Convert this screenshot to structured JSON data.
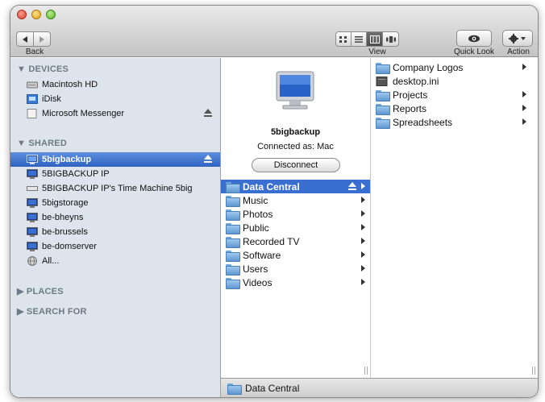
{
  "toolbar": {
    "back_label": "Back",
    "view_label": "View",
    "quicklook_label": "Quick Look",
    "action_label": "Action"
  },
  "sidebar": {
    "devices_header": "▼ DEVICES",
    "devices": [
      {
        "label": "Macintosh HD",
        "icon": "hard-drive-icon"
      },
      {
        "label": "iDisk",
        "icon": "idisk-icon"
      },
      {
        "label": "Microsoft Messenger",
        "icon": "disk-image-icon",
        "eject": true
      }
    ],
    "shared_header": "▼ SHARED",
    "shared": [
      {
        "label": "5bigbackup",
        "icon": "server-icon",
        "selected": true,
        "eject": true
      },
      {
        "label": "5BIGBACKUP IP",
        "icon": "server-icon"
      },
      {
        "label": "5BIGBACKUP IP's Time Machine 5big",
        "icon": "time-machine-icon"
      },
      {
        "label": "5bigstorage",
        "icon": "server-icon"
      },
      {
        "label": "be-bheyns",
        "icon": "server-icon"
      },
      {
        "label": "be-brussels",
        "icon": "server-icon"
      },
      {
        "label": "be-domserver",
        "icon": "server-icon"
      },
      {
        "label": "All...",
        "icon": "network-globe-icon"
      }
    ],
    "places_header": "▶ PLACES",
    "search_header": "▶ SEARCH FOR"
  },
  "server": {
    "name": "5bigbackup",
    "connected_as": "Connected as: Mac",
    "disconnect_label": "Disconnect"
  },
  "column2": [
    {
      "label": "Data Central",
      "selected": true
    },
    {
      "label": "Music"
    },
    {
      "label": "Photos"
    },
    {
      "label": "Public"
    },
    {
      "label": "Recorded TV"
    },
    {
      "label": "Software"
    },
    {
      "label": "Users"
    },
    {
      "label": "Videos"
    }
  ],
  "column3": [
    {
      "label": "Company Logos",
      "type": "folder",
      "arrow": true
    },
    {
      "label": "desktop.ini",
      "type": "file",
      "arrow": false
    },
    {
      "label": "Projects",
      "type": "folder",
      "arrow": true
    },
    {
      "label": "Reports",
      "type": "folder",
      "arrow": true
    },
    {
      "label": "Spreadsheets",
      "type": "folder",
      "arrow": true
    }
  ],
  "statusbar": {
    "path_label": "Data Central"
  },
  "colors": {
    "selection": "#3a6fd2",
    "sidebar_bg": "#dde4ec"
  }
}
